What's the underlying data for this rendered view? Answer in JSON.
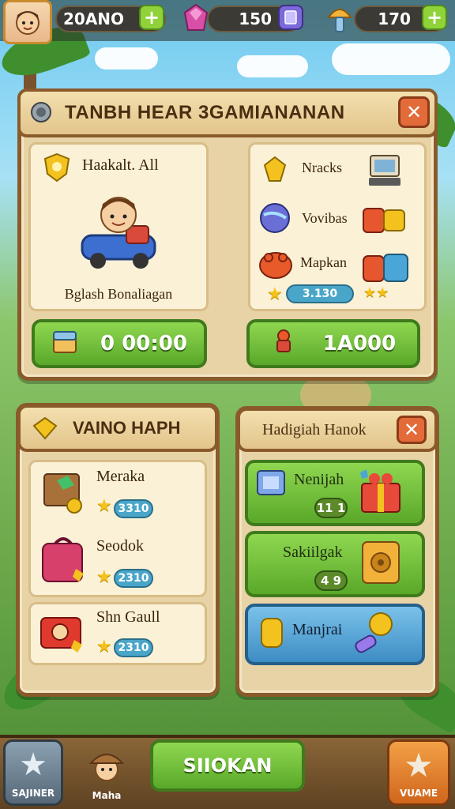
{
  "topbar": {
    "coins": "20ANO",
    "gems": "150",
    "keys": "170",
    "plus": "+"
  },
  "panel_top": {
    "title": "TANBH HEAR 3GAMIANANAN",
    "close": "✕",
    "hero_name": "Haakalt. All",
    "hero_caption": "Bglash Bonaliagan",
    "timer": "0 00:00",
    "price": "1A000",
    "items": [
      {
        "label": "Nracks"
      },
      {
        "label": "Vovibas"
      },
      {
        "label": "Mapkan",
        "tag": "3.130"
      }
    ]
  },
  "panel_left": {
    "title": "VAINO HAPH",
    "items": [
      {
        "label": "Meraka",
        "price": "3310"
      },
      {
        "label": "Seodok",
        "price": "2310"
      },
      {
        "label": "Shn Gaull",
        "price": "2310"
      }
    ]
  },
  "panel_right": {
    "title": "Hadigiah Hanok",
    "close": "✕",
    "items": [
      {
        "label": "Nenijah",
        "count": "11 1"
      },
      {
        "label": "Sakiilgak",
        "count": "4 9"
      },
      {
        "label": "Manjrai"
      }
    ]
  },
  "bottom_nav": {
    "left_label": "SAJINER",
    "center_label": "Maha",
    "main_button": "SIIOKAN",
    "right_label": "VUAME"
  },
  "colors": {
    "wood": "#8a5a2b",
    "parchment": "#e8d3a6",
    "green": "#6bbb3a",
    "blue": "#3d8cc4",
    "close_red": "#e36b3a"
  },
  "icons": [
    "plus-icon",
    "gem-icon",
    "mushroom-icon",
    "star-icon",
    "close-icon",
    "chest-icon",
    "gift-icon",
    "shield-icon"
  ]
}
